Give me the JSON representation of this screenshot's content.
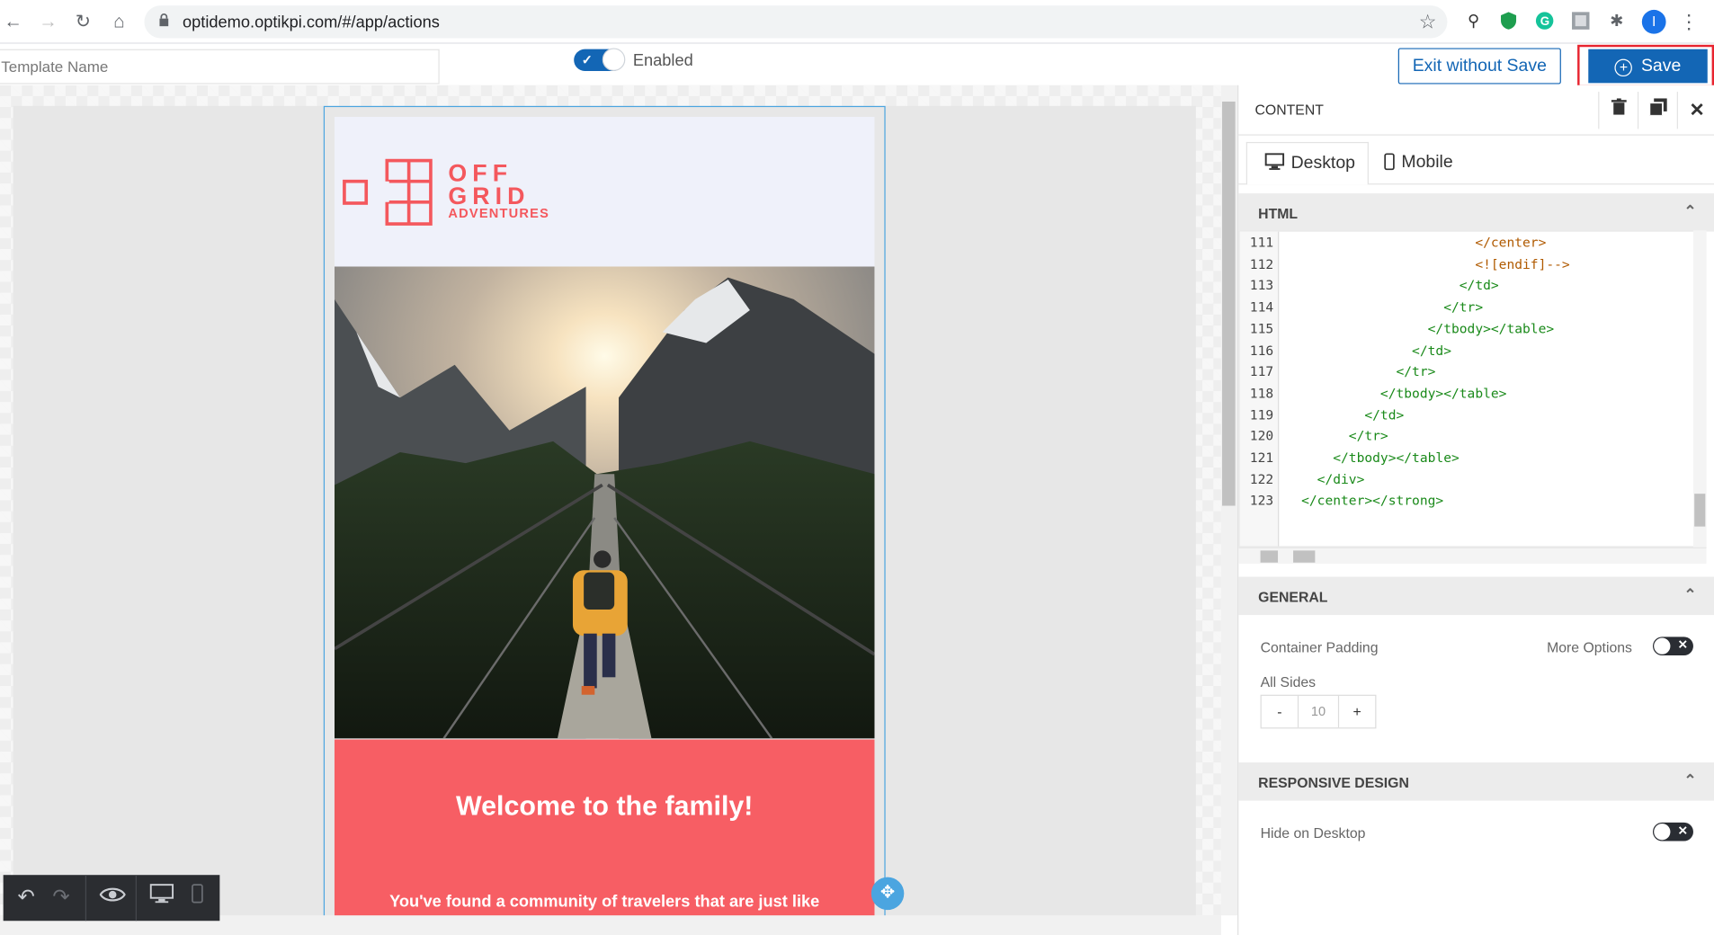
{
  "browser": {
    "url": "optidemo.optikpi.com/#/app/actions",
    "profile_initial": "I"
  },
  "topbar": {
    "template_name_placeholder": "Template Name",
    "enabled_label": "Enabled",
    "exit_label": "Exit without Save",
    "save_label": "Save"
  },
  "email": {
    "logo_line1": "OFF",
    "logo_line2": "GRID",
    "logo_line3": "ADVENTURES",
    "heading": "Welcome to the family!",
    "body_text": "You've found a community of travelers that are just like"
  },
  "panel": {
    "title": "CONTENT",
    "tabs": [
      {
        "label": "Desktop"
      },
      {
        "label": "Mobile"
      }
    ],
    "html_section": "HTML",
    "code_lines": [
      {
        "n": "111",
        "text": "                        </center>",
        "kind": "cmt"
      },
      {
        "n": "112",
        "text": "                        <![endif]-->",
        "kind": "cmt"
      },
      {
        "n": "113",
        "text": "                      </td>",
        "kind": "tag"
      },
      {
        "n": "114",
        "text": "                    </tr>",
        "kind": "tag"
      },
      {
        "n": "115",
        "text": "                  </tbody></table>",
        "kind": "tag"
      },
      {
        "n": "116",
        "text": "                </td>",
        "kind": "tag"
      },
      {
        "n": "117",
        "text": "              </tr>",
        "kind": "tag"
      },
      {
        "n": "118",
        "text": "            </tbody></table>",
        "kind": "tag"
      },
      {
        "n": "119",
        "text": "          </td>",
        "kind": "tag"
      },
      {
        "n": "120",
        "text": "        </tr>",
        "kind": "tag"
      },
      {
        "n": "121",
        "text": "      </tbody></table>",
        "kind": "tag"
      },
      {
        "n": "122",
        "text": "    </div>",
        "kind": "tag"
      },
      {
        "n": "123",
        "text": "  </center></strong>",
        "kind": "tag"
      }
    ],
    "general_section": "GENERAL",
    "container_padding": "Container Padding",
    "more_options": "More Options",
    "all_sides": "All Sides",
    "padding_minus": "-",
    "padding_value": "10",
    "padding_plus": "+",
    "responsive_section": "RESPONSIVE DESIGN",
    "hide_on_desktop": "Hide on Desktop"
  },
  "colors": {
    "primary": "#1366b5",
    "coral": "#f75e64",
    "highlight": "#e8242f"
  },
  "icons": [
    "back-icon",
    "forward-icon",
    "reload-icon",
    "home-icon",
    "lock-icon",
    "star-icon",
    "trash-icon",
    "duplicate-icon",
    "close-icon",
    "desktop-icon",
    "mobile-icon",
    "undo-icon",
    "redo-icon",
    "eye-icon",
    "move-icon",
    "chevron-up-icon"
  ]
}
